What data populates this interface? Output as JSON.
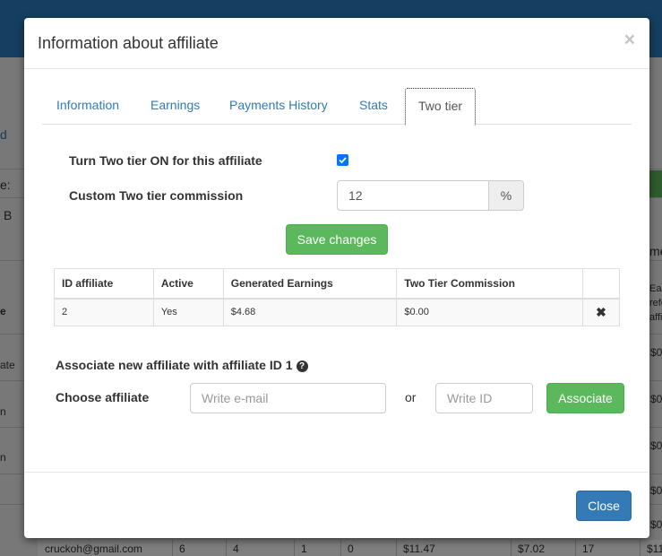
{
  "background": {
    "left_labels": [
      "d",
      "e:",
      "B",
      "e",
      "ate",
      "n",
      "n"
    ],
    "right_labels": [
      "me",
      "Ear",
      "refe",
      "affi",
      "$0",
      "$0",
      "$0",
      "$0",
      "$0"
    ],
    "bottom_row": {
      "email": "cruckoh@gmail.com",
      "cells": [
        "6",
        "4",
        "1",
        "0",
        "$11.47",
        "$7.02",
        "17",
        "$11"
      ]
    }
  },
  "modal": {
    "title": "Information about affiliate",
    "close_symbol": "×",
    "tabs": [
      {
        "label": "Information"
      },
      {
        "label": "Earnings"
      },
      {
        "label": "Payments History"
      },
      {
        "label": "Stats"
      },
      {
        "label": "Two tier",
        "active": true
      }
    ],
    "two_tier": {
      "toggle_label": "Turn Two tier ON for this affiliate",
      "toggle_checked": true,
      "commission_label": "Custom Two tier commission",
      "commission_value": "12",
      "commission_unit": "%",
      "save_label": "Save changes"
    },
    "table": {
      "headers": [
        "ID affiliate",
        "Active",
        "Generated Earnings",
        "Two Tier Commission",
        ""
      ],
      "rows": [
        {
          "id": "2",
          "active": "Yes",
          "earnings": "$4.68",
          "commission": "$0.00",
          "remove_symbol": "✖"
        }
      ]
    },
    "associate": {
      "heading": "Associate new affiliate with affiliate ID 1",
      "help_symbol": "?",
      "choose_label": "Choose affiliate",
      "email_placeholder": "Write e-mail",
      "or_label": "or",
      "id_placeholder": "Write ID",
      "button_label": "Associate"
    },
    "footer": {
      "close_label": "Close"
    },
    "colors": {
      "primary": "#337ab7",
      "success": "#5cb85c",
      "checkbox": "#0075ff"
    }
  }
}
